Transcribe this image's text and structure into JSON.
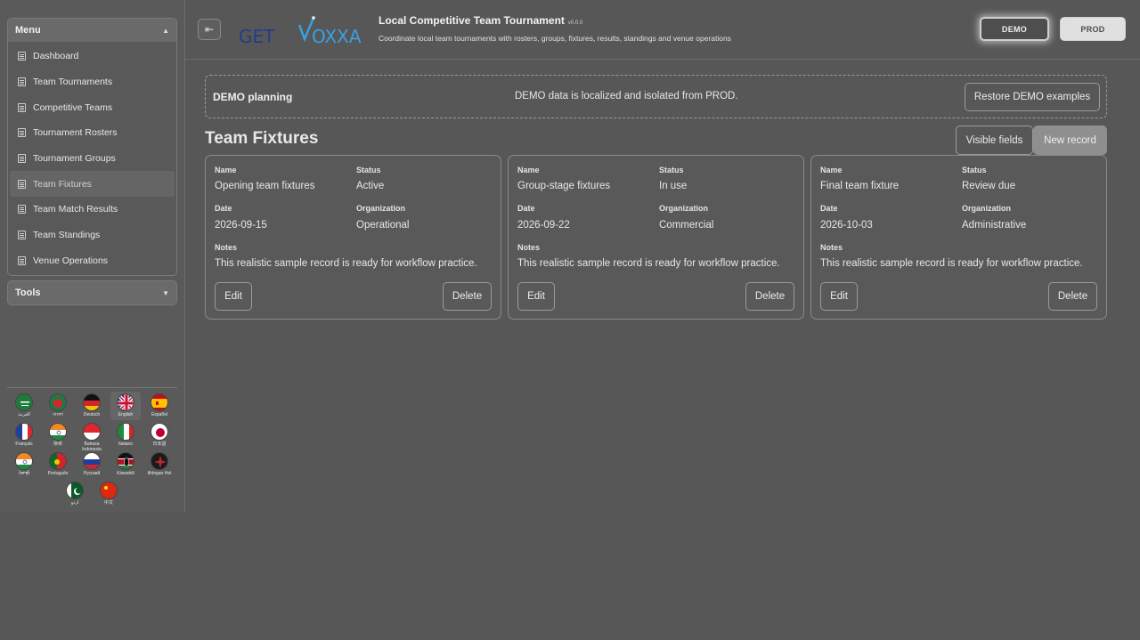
{
  "sidebar": {
    "menu_title": "Menu",
    "tools_title": "Tools",
    "items": [
      {
        "label": "Dashboard"
      },
      {
        "label": "Team Tournaments"
      },
      {
        "label": "Competitive Teams"
      },
      {
        "label": "Tournament Rosters"
      },
      {
        "label": "Tournament Groups"
      },
      {
        "label": "Team Fixtures"
      },
      {
        "label": "Team Match Results"
      },
      {
        "label": "Team Standings"
      },
      {
        "label": "Venue Operations"
      }
    ],
    "active_item": "Team Fixtures",
    "languages": [
      {
        "label": "العربية",
        "flag": "saudi-arabia"
      },
      {
        "label": "বাংলা",
        "flag": "bangladesh"
      },
      {
        "label": "Deutsch",
        "flag": "germany"
      },
      {
        "label": "English",
        "flag": "united-kingdom"
      },
      {
        "label": "Español",
        "flag": "spain"
      },
      {
        "label": "Français",
        "flag": "france"
      },
      {
        "label": "हिन्दी",
        "flag": "india"
      },
      {
        "label": "Bahasa Indonesia",
        "flag": "indonesia"
      },
      {
        "label": "Italiano",
        "flag": "italy"
      },
      {
        "label": "日本語",
        "flag": "japan"
      },
      {
        "label": "ਪੰਜਾਬੀ",
        "flag": "india"
      },
      {
        "label": "Português",
        "flag": "portugal"
      },
      {
        "label": "Русский",
        "flag": "russia"
      },
      {
        "label": "Kiswahili",
        "flag": "kenya"
      },
      {
        "label": "tlhIngan Hol",
        "flag": "klingon"
      },
      {
        "label": "اردو",
        "flag": "pakistan"
      },
      {
        "label": "中文",
        "flag": "china"
      }
    ],
    "selected_language": "English"
  },
  "header": {
    "logo_text_left": "GET",
    "logo_text_right": "OXXA",
    "title": "Local Competitive Team Tournament",
    "version": "v0.0.0",
    "subtitle": "Coordinate local team tournaments with rosters, groups, fixtures, results, standings and venue operations",
    "env_demo": "DEMO",
    "env_prod": "PROD",
    "active_env": "DEMO"
  },
  "banner": {
    "title": "DEMO planning",
    "text": "DEMO data is localized and isolated from PROD.",
    "restore_label": "Restore DEMO examples"
  },
  "main": {
    "section_title": "Team Fixtures",
    "visible_fields_label": "Visible fields",
    "new_record_label": "New record",
    "labels": {
      "name": "Name",
      "status": "Status",
      "date": "Date",
      "organization": "Organization",
      "notes": "Notes",
      "edit": "Edit",
      "delete": "Delete"
    },
    "records": [
      {
        "name": "Opening team fixtures",
        "status": "Active",
        "date": "2026-09-15",
        "organization": "Operational",
        "notes": "This realistic sample record is ready for workflow practice."
      },
      {
        "name": "Group-stage fixtures",
        "status": "In use",
        "date": "2026-09-22",
        "organization": "Commercial",
        "notes": "This realistic sample record is ready for workflow practice."
      },
      {
        "name": "Final team fixture",
        "status": "Review due",
        "date": "2026-10-03",
        "organization": "Administrative",
        "notes": "This realistic sample record is ready for workflow practice."
      }
    ]
  },
  "colors": {
    "background": "#575757",
    "panel_header": "#6a6a6a",
    "logo_blue": "#3aa0e0",
    "logo_navy": "#1f3f8a",
    "new_record_bg": "#8f8f8f"
  }
}
